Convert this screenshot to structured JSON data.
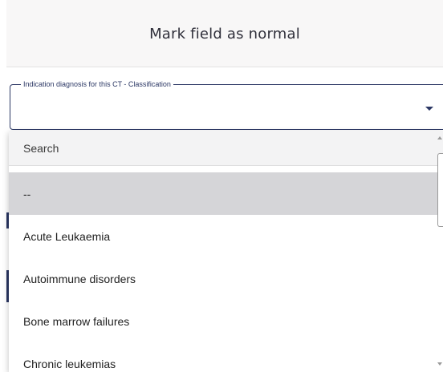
{
  "modal": {
    "title": "Mark field as normal"
  },
  "field": {
    "label": "Indication diagnosis for this CT - Classification",
    "value": ""
  },
  "dropdown": {
    "search_placeholder": "Search",
    "options": [
      {
        "label": "--",
        "selected": true
      },
      {
        "label": "Acute Leukaemia",
        "selected": false
      },
      {
        "label": "Autoimmune disorders",
        "selected": false
      },
      {
        "label": "Bone marrow failures",
        "selected": false
      },
      {
        "label": "Chronic leukemias",
        "selected": false
      }
    ]
  },
  "colors": {
    "accent": "#2b3764",
    "selected_option_bg": "#d5d5d8",
    "header_bg": "#f8f7f7"
  },
  "icons": {
    "dropdown_caret": "caret-down-icon"
  }
}
